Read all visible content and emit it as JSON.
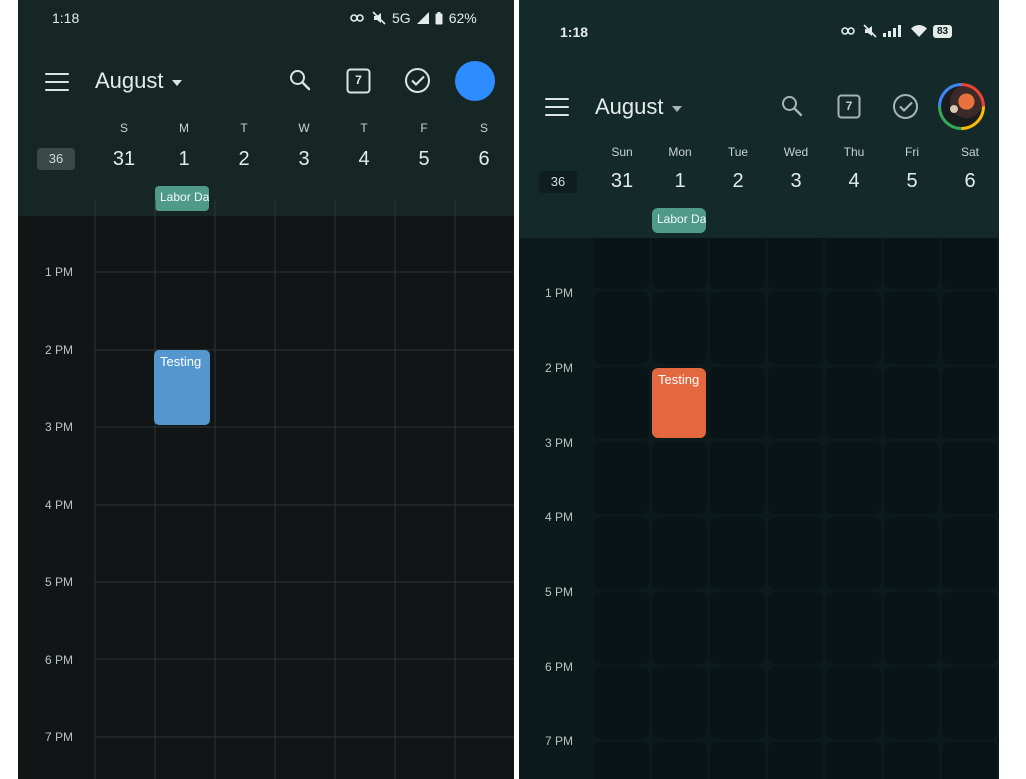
{
  "left": {
    "status": {
      "time": "1:18",
      "network": "5G",
      "battery": "62%"
    },
    "header": {
      "month": "August"
    },
    "week_number": "36",
    "days": [
      {
        "name": "S",
        "num": "31"
      },
      {
        "name": "M",
        "num": "1"
      },
      {
        "name": "T",
        "num": "2"
      },
      {
        "name": "W",
        "num": "3"
      },
      {
        "name": "T",
        "num": "4"
      },
      {
        "name": "F",
        "num": "5"
      },
      {
        "name": "S",
        "num": "6"
      }
    ],
    "allday_event": "Labor Da",
    "hours": [
      "1 PM",
      "2 PM",
      "3 PM",
      "4 PM",
      "5 PM",
      "6 PM",
      "7 PM"
    ],
    "event": {
      "title": "Testing",
      "color": "#5497cf"
    },
    "today_icon_num": "7",
    "avatar_color": "#2d8cff"
  },
  "right": {
    "status": {
      "time": "1:18",
      "battery": "83"
    },
    "header": {
      "month": "August"
    },
    "week_number": "36",
    "days": [
      {
        "name": "Sun",
        "num": "31"
      },
      {
        "name": "Mon",
        "num": "1"
      },
      {
        "name": "Tue",
        "num": "2"
      },
      {
        "name": "Wed",
        "num": "3"
      },
      {
        "name": "Thu",
        "num": "4"
      },
      {
        "name": "Fri",
        "num": "5"
      },
      {
        "name": "Sat",
        "num": "6"
      }
    ],
    "allday_event": "Labor Da",
    "hours": [
      "1 PM",
      "2 PM",
      "3 PM",
      "4 PM",
      "5 PM",
      "6 PM",
      "7 PM"
    ],
    "event": {
      "title": "Testing",
      "color": "#e4683f"
    },
    "today_icon_num": "7"
  },
  "icons": [
    "menu-icon",
    "dropdown-caret-icon",
    "search-icon",
    "today-calendar-icon",
    "tasks-check-icon",
    "account-avatar",
    "key-icon",
    "mute-icon",
    "signal-icon",
    "wifi-icon",
    "battery-icon"
  ]
}
